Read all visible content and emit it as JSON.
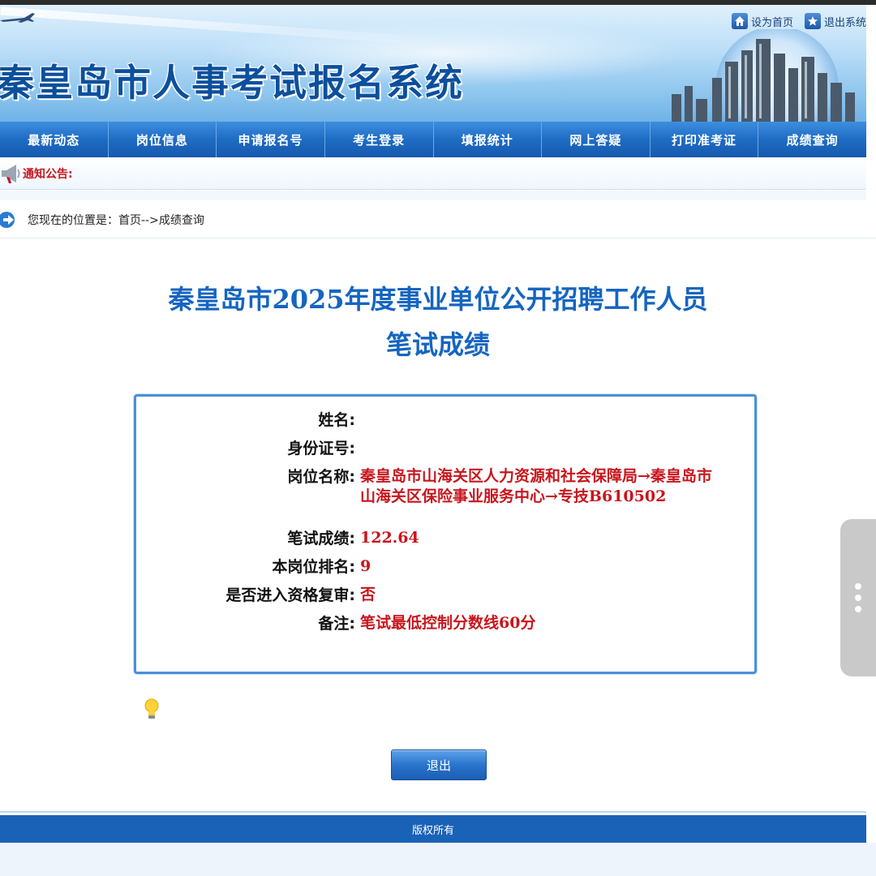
{
  "header": {
    "site_title": "秦皇岛市人事考试报名系统",
    "links": [
      {
        "label": "设为首页",
        "icon": "home-icon"
      },
      {
        "label": "退出系统",
        "icon": "star-icon"
      }
    ]
  },
  "nav": {
    "items": [
      "最新动态",
      "岗位信息",
      "申请报名号",
      "考生登录",
      "填报统计",
      "网上答疑",
      "打印准考证",
      "成绩查询"
    ]
  },
  "notice": {
    "label": "通知公告:"
  },
  "breadcrumb": {
    "text": "您现在的位置是：首页-->成绩查询"
  },
  "result": {
    "title": "秦皇岛市2025年度事业单位公开招聘工作人员",
    "subtitle": "笔试成绩",
    "fields": [
      {
        "label": "姓名:",
        "value": ""
      },
      {
        "label": "身份证号:",
        "value": ""
      },
      {
        "label": "岗位名称:",
        "value": "秦皇岛市山海关区人力资源和社会保障局→秦皇岛市山海关区保险事业服务中心→专技B610502"
      },
      {
        "label": "笔试成绩:",
        "value": "122.64"
      },
      {
        "label": "本岗位排名:",
        "value": "9"
      },
      {
        "label": "是否进入资格复审:",
        "value": "否"
      },
      {
        "label": "备注:",
        "value": "笔试最低控制分数线60分"
      }
    ]
  },
  "actions": {
    "exit_label": "退出"
  },
  "footer": {
    "text": "版权所有"
  },
  "colors": {
    "primary_blue": "#1565c0",
    "nav_blue": "#1e6cc4",
    "value_red": "#c8161d"
  }
}
